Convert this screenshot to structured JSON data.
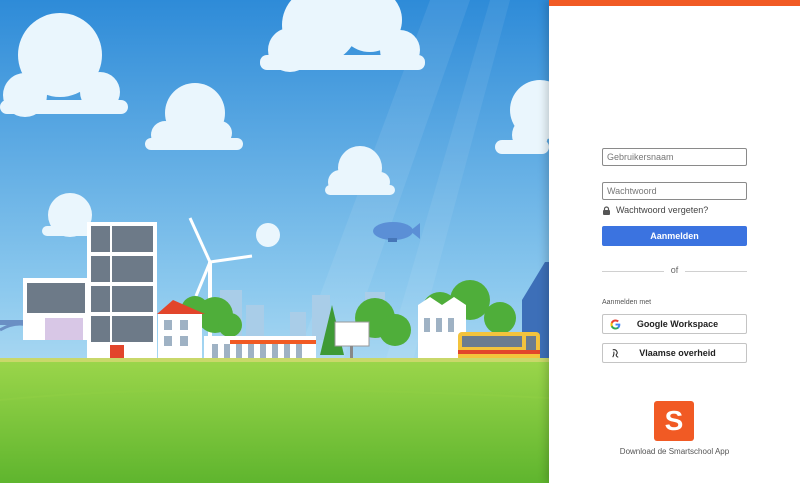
{
  "colors": {
    "accent": "#f15a24",
    "primary_button": "#3b73e0",
    "sky_top": "#2f8fdb",
    "sky_bottom": "#bfe3f5",
    "grass": "#7ccb3c"
  },
  "illustration": {
    "name": "school-town-illustration"
  },
  "login": {
    "username_placeholder": "Gebruikersnaam",
    "password_placeholder": "Wachtwoord",
    "forgot_label": "Wachtwoord vergeten?",
    "submit_label": "Aanmelden",
    "or_label": "of",
    "sign_in_with_label": "Aanmelden met",
    "providers": [
      {
        "label": "Google Workspace",
        "icon": "google-icon"
      },
      {
        "label": "Vlaamse overheid",
        "icon": "vlaamse-overheid-icon"
      }
    ]
  },
  "app": {
    "logo_letter": "S",
    "download_label": "Download de Smartschool App"
  }
}
